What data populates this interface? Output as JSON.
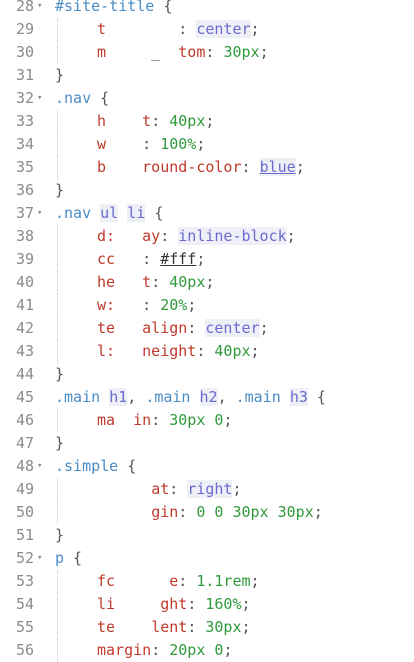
{
  "editor": {
    "lines": [
      {
        "n": "28",
        "fold": true,
        "indent": 0,
        "tokens": [
          {
            "t": "#site-title",
            "c": "sel"
          },
          {
            "t": " {",
            "c": "pun"
          }
        ]
      },
      {
        "n": "29",
        "fold": false,
        "indent": 1,
        "tokens": [
          {
            "t": "t",
            "c": "prop"
          },
          {
            "t": "        ",
            "c": "pun"
          },
          {
            "t": ": ",
            "c": "pun"
          },
          {
            "t": "center",
            "c": "val"
          },
          {
            "t": ";",
            "c": "pun"
          }
        ]
      },
      {
        "n": "30",
        "fold": false,
        "indent": 1,
        "tokens": [
          {
            "t": "m",
            "c": "prop"
          },
          {
            "t": "     _  ",
            "c": "pun"
          },
          {
            "t": "tom",
            "c": "prop"
          },
          {
            "t": ": ",
            "c": "pun"
          },
          {
            "t": "30px",
            "c": "num"
          },
          {
            "t": ";",
            "c": "pun"
          }
        ]
      },
      {
        "n": "31",
        "fold": false,
        "indent": 0,
        "tokens": [
          {
            "t": "}",
            "c": "pun"
          }
        ]
      },
      {
        "n": "32",
        "fold": true,
        "indent": 0,
        "tokens": [
          {
            "t": ".nav",
            "c": "sel"
          },
          {
            "t": " {",
            "c": "pun"
          }
        ]
      },
      {
        "n": "33",
        "fold": false,
        "indent": 1,
        "tokens": [
          {
            "t": "h",
            "c": "prop"
          },
          {
            "t": "    ",
            "c": "pun"
          },
          {
            "t": "t",
            "c": "prop"
          },
          {
            "t": ": ",
            "c": "pun"
          },
          {
            "t": "40px",
            "c": "num"
          },
          {
            "t": ";",
            "c": "pun"
          }
        ]
      },
      {
        "n": "34",
        "fold": false,
        "indent": 1,
        "tokens": [
          {
            "t": "w",
            "c": "prop"
          },
          {
            "t": "    ",
            "c": "pun"
          },
          {
            "t": ": ",
            "c": "pun"
          },
          {
            "t": "100%",
            "c": "num"
          },
          {
            "t": ";",
            "c": "pun"
          }
        ]
      },
      {
        "n": "35",
        "fold": false,
        "indent": 1,
        "tokens": [
          {
            "t": "b",
            "c": "prop"
          },
          {
            "t": "    ",
            "c": "pun"
          },
          {
            "t": "round-color",
            "c": "prop"
          },
          {
            "t": ": ",
            "c": "pun"
          },
          {
            "t": "blue",
            "c": "val uline"
          },
          {
            "t": ";",
            "c": "pun"
          }
        ]
      },
      {
        "n": "36",
        "fold": false,
        "indent": 0,
        "tokens": [
          {
            "t": "}",
            "c": "pun"
          }
        ]
      },
      {
        "n": "37",
        "fold": true,
        "indent": 0,
        "tokens": [
          {
            "t": ".nav ",
            "c": "sel"
          },
          {
            "t": "ul",
            "c": "val"
          },
          {
            "t": " ",
            "c": "pun"
          },
          {
            "t": "li",
            "c": "val"
          },
          {
            "t": " {",
            "c": "pun"
          }
        ]
      },
      {
        "n": "38",
        "fold": false,
        "indent": 1,
        "tokens": [
          {
            "t": "d:",
            "c": "prop"
          },
          {
            "t": "   ",
            "c": "pun"
          },
          {
            "t": "ay",
            "c": "prop"
          },
          {
            "t": ": ",
            "c": "pun"
          },
          {
            "t": "inline-block",
            "c": "val"
          },
          {
            "t": ";",
            "c": "pun"
          }
        ]
      },
      {
        "n": "39",
        "fold": false,
        "indent": 1,
        "tokens": [
          {
            "t": "cc",
            "c": "prop"
          },
          {
            "t": "   ",
            "c": "pun"
          },
          {
            "t": ": ",
            "c": "pun"
          },
          {
            "t": "#fff",
            "c": "hex"
          },
          {
            "t": ";",
            "c": "pun"
          }
        ]
      },
      {
        "n": "40",
        "fold": false,
        "indent": 1,
        "tokens": [
          {
            "t": "he",
            "c": "prop"
          },
          {
            "t": "   ",
            "c": "pun"
          },
          {
            "t": "t",
            "c": "prop"
          },
          {
            "t": ": ",
            "c": "pun"
          },
          {
            "t": "40px",
            "c": "num"
          },
          {
            "t": ";",
            "c": "pun"
          }
        ]
      },
      {
        "n": "41",
        "fold": false,
        "indent": 1,
        "tokens": [
          {
            "t": "w:",
            "c": "prop"
          },
          {
            "t": "   ",
            "c": "pun"
          },
          {
            "t": ": ",
            "c": "pun"
          },
          {
            "t": "20%",
            "c": "num"
          },
          {
            "t": ";",
            "c": "pun"
          }
        ]
      },
      {
        "n": "42",
        "fold": false,
        "indent": 1,
        "tokens": [
          {
            "t": "te",
            "c": "prop"
          },
          {
            "t": "   ",
            "c": "pun"
          },
          {
            "t": "align",
            "c": "prop"
          },
          {
            "t": ": ",
            "c": "pun"
          },
          {
            "t": "center",
            "c": "val"
          },
          {
            "t": ";",
            "c": "pun"
          }
        ]
      },
      {
        "n": "43",
        "fold": false,
        "indent": 1,
        "tokens": [
          {
            "t": "l:",
            "c": "prop"
          },
          {
            "t": "   ",
            "c": "pun"
          },
          {
            "t": "neight",
            "c": "prop"
          },
          {
            "t": ": ",
            "c": "pun"
          },
          {
            "t": "40px",
            "c": "num"
          },
          {
            "t": ";",
            "c": "pun"
          }
        ]
      },
      {
        "n": "44",
        "fold": false,
        "indent": 0,
        "tokens": [
          {
            "t": "}",
            "c": "pun"
          }
        ]
      },
      {
        "n": "45",
        "fold": false,
        "indent": 0,
        "tokens": [
          {
            "t": ".main ",
            "c": "sel"
          },
          {
            "t": "h1",
            "c": "val"
          },
          {
            "t": ", ",
            "c": "pun"
          },
          {
            "t": ".main ",
            "c": "sel"
          },
          {
            "t": "h2",
            "c": "val"
          },
          {
            "t": ", ",
            "c": "pun"
          },
          {
            "t": ".main ",
            "c": "sel"
          },
          {
            "t": "h3",
            "c": "val"
          },
          {
            "t": " {",
            "c": "pun"
          }
        ]
      },
      {
        "n": "46",
        "fold": false,
        "indent": 1,
        "tokens": [
          {
            "t": "ma",
            "c": "prop"
          },
          {
            "t": "  ",
            "c": "pun"
          },
          {
            "t": "in",
            "c": "prop"
          },
          {
            "t": ": ",
            "c": "pun"
          },
          {
            "t": "30px 0",
            "c": "num"
          },
          {
            "t": ";",
            "c": "pun"
          }
        ]
      },
      {
        "n": "47",
        "fold": false,
        "indent": 0,
        "tokens": [
          {
            "t": "}",
            "c": "pun"
          }
        ]
      },
      {
        "n": "48",
        "fold": true,
        "indent": 0,
        "tokens": [
          {
            "t": ".simple",
            "c": "sel"
          },
          {
            "t": " {",
            "c": "pun"
          }
        ]
      },
      {
        "n": "49",
        "fold": false,
        "indent": 1,
        "tokens": [
          {
            "t": "      ",
            "c": "pun"
          },
          {
            "t": "at",
            "c": "prop"
          },
          {
            "t": ": ",
            "c": "pun"
          },
          {
            "t": "right",
            "c": "val"
          },
          {
            "t": ";",
            "c": "pun"
          }
        ]
      },
      {
        "n": "50",
        "fold": false,
        "indent": 1,
        "tokens": [
          {
            "t": "      ",
            "c": "pun"
          },
          {
            "t": "gin",
            "c": "prop"
          },
          {
            "t": ": ",
            "c": "pun"
          },
          {
            "t": "0 0 30px 30px",
            "c": "num"
          },
          {
            "t": ";",
            "c": "pun"
          }
        ]
      },
      {
        "n": "51",
        "fold": false,
        "indent": 0,
        "tokens": [
          {
            "t": "}",
            "c": "pun"
          }
        ]
      },
      {
        "n": "52",
        "fold": true,
        "indent": 0,
        "tokens": [
          {
            "t": "p",
            "c": "sel"
          },
          {
            "t": " {",
            "c": "pun"
          }
        ]
      },
      {
        "n": "53",
        "fold": false,
        "indent": 1,
        "tokens": [
          {
            "t": "fc",
            "c": "prop"
          },
          {
            "t": "      ",
            "c": "pun"
          },
          {
            "t": "e",
            "c": "prop"
          },
          {
            "t": ": ",
            "c": "pun"
          },
          {
            "t": "1.1rem",
            "c": "num"
          },
          {
            "t": ";",
            "c": "pun"
          }
        ]
      },
      {
        "n": "54",
        "fold": false,
        "indent": 1,
        "tokens": [
          {
            "t": "li",
            "c": "prop"
          },
          {
            "t": "     ",
            "c": "pun"
          },
          {
            "t": "ght",
            "c": "prop"
          },
          {
            "t": ": ",
            "c": "pun"
          },
          {
            "t": "160%",
            "c": "num"
          },
          {
            "t": ";",
            "c": "pun"
          }
        ]
      },
      {
        "n": "55",
        "fold": false,
        "indent": 1,
        "tokens": [
          {
            "t": "te",
            "c": "prop"
          },
          {
            "t": "    ",
            "c": "pun"
          },
          {
            "t": "lent",
            "c": "prop"
          },
          {
            "t": ": ",
            "c": "pun"
          },
          {
            "t": "30px",
            "c": "num"
          },
          {
            "t": ";",
            "c": "pun"
          }
        ]
      },
      {
        "n": "56",
        "fold": false,
        "indent": 1,
        "tokens": [
          {
            "t": "margin",
            "c": "prop"
          },
          {
            "t": ": ",
            "c": "pun"
          },
          {
            "t": "20px 0",
            "c": "num"
          },
          {
            "t": ";",
            "c": "pun"
          }
        ]
      }
    ]
  }
}
